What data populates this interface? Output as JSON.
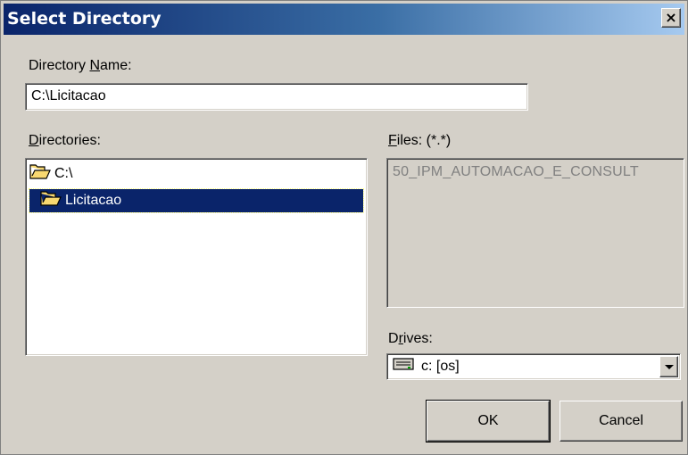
{
  "window": {
    "title": "Select Directory",
    "close_glyph": "×"
  },
  "directory_name": {
    "label_pre": "Directory ",
    "label_mnemonic": "N",
    "label_post": "ame:",
    "value": "C:\\Licitacao"
  },
  "directories": {
    "label_mnemonic": "D",
    "label_post": "irectories:",
    "items": [
      {
        "label": "C:\\",
        "icon": "open-folder-icon",
        "selected": false
      },
      {
        "label": "Licitacao",
        "icon": "open-folder-icon",
        "selected": true
      }
    ]
  },
  "files": {
    "label_mnemonic": "F",
    "label_post": "iles: (*.*)",
    "items": [
      "50_IPM_AUTOMACAO_E_CONSULT"
    ]
  },
  "drives": {
    "label_pre": "D",
    "label_mnemonic": "r",
    "label_post": "ives:",
    "selected": "c: [os]",
    "icon": "hard-drive-icon"
  },
  "buttons": {
    "ok": "OK",
    "cancel": "Cancel"
  },
  "colors": {
    "title_start": "#0a246a",
    "title_end": "#a6caf0",
    "selection": "#0a246a",
    "dialog_bg": "#d4d0c8",
    "folder": "#f8d870"
  }
}
